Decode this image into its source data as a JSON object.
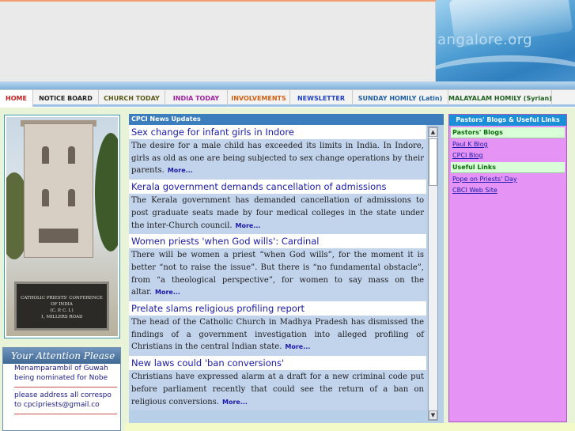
{
  "banner": {
    "site_text": "angalore.org"
  },
  "nav": {
    "items": [
      {
        "label": "HOME",
        "color": "#c02020"
      },
      {
        "label": "NOTICE BOARD",
        "color": "#222222"
      },
      {
        "label": "CHURCH TODAY",
        "color": "#5a5a1a"
      },
      {
        "label": "INDIA TODAY",
        "color": "#a020a0"
      },
      {
        "label": "INVOLVEMENTS",
        "color": "#d06010"
      },
      {
        "label": "NEWSLETTER",
        "color": "#2040c0"
      },
      {
        "label": "SUNDAY HOMILY (Latin)",
        "color": "#2060a0"
      },
      {
        "label": "MALAYALAM HOMILY (Syrian)",
        "color": "#206020"
      }
    ]
  },
  "photo": {
    "sign_lines": [
      "CATHOLIC PRIESTS' CONFERENCE",
      "OF INDIA",
      "(C. P. C. I.)",
      "1, MILLERS ROAD"
    ]
  },
  "attention": {
    "title": "Your Attention Please",
    "lines": [
      "Menamparambil of Guwah",
      "being nominated for Nobe",
      "please address all correspo",
      "to cpcipriests@gmail.co"
    ]
  },
  "news": {
    "header": "CPCI News Updates",
    "more_label": "More...",
    "items": [
      {
        "title": "Sex change for infant girls in Indore",
        "summary": "The desire for a male child has exceeded its limits in India. In Indore, girls as old as one are being subjected to sex change operations by their parents."
      },
      {
        "title": "Kerala government demands cancellation of admissions",
        "summary": "The Kerala government has demanded cancellation of admissions to post graduate seats made by four medical colleges in the state under the inter-Church council."
      },
      {
        "title": "Women priests 'when God wills': Cardinal",
        "summary": "There will be women a priest “when God wills”, for the moment it is better “not to raise the issue”. But there is “no fundamental obstacle”, from “a theological perspective”, for women to say mass on the altar."
      },
      {
        "title": "Prelate slams religious profiling report",
        "summary": "The head of the Catholic Church in Madhya Pradesh has dismissed the findings of a government investigation into alleged profiling of Christians in the central Indian state."
      },
      {
        "title": "New laws could 'ban conversions'",
        "summary": "Christians have expressed alarm at a draft for a new criminal code put before parliament recently that could see the return of a ban on religious conversions."
      }
    ]
  },
  "sidebar": {
    "header": "Pastors' Blogs & Useful Links",
    "sections": [
      {
        "title": "Pastors' Blogs",
        "links": [
          "Paul K Blog",
          "CPCI Blog"
        ]
      },
      {
        "title": "Useful Links",
        "links": [
          "Pope on Priests' Day",
          "CBCI Web Site"
        ]
      }
    ]
  },
  "colors": {
    "nav_underline": "#9fc3e6",
    "news_header_bg": "#3b7dbd",
    "news_summary_bg": "#c2d3ec",
    "link_blue": "#1a1aa8",
    "sidebar_bg": "#e594f5",
    "sidebar_header_bg": "#1a8fd8"
  }
}
